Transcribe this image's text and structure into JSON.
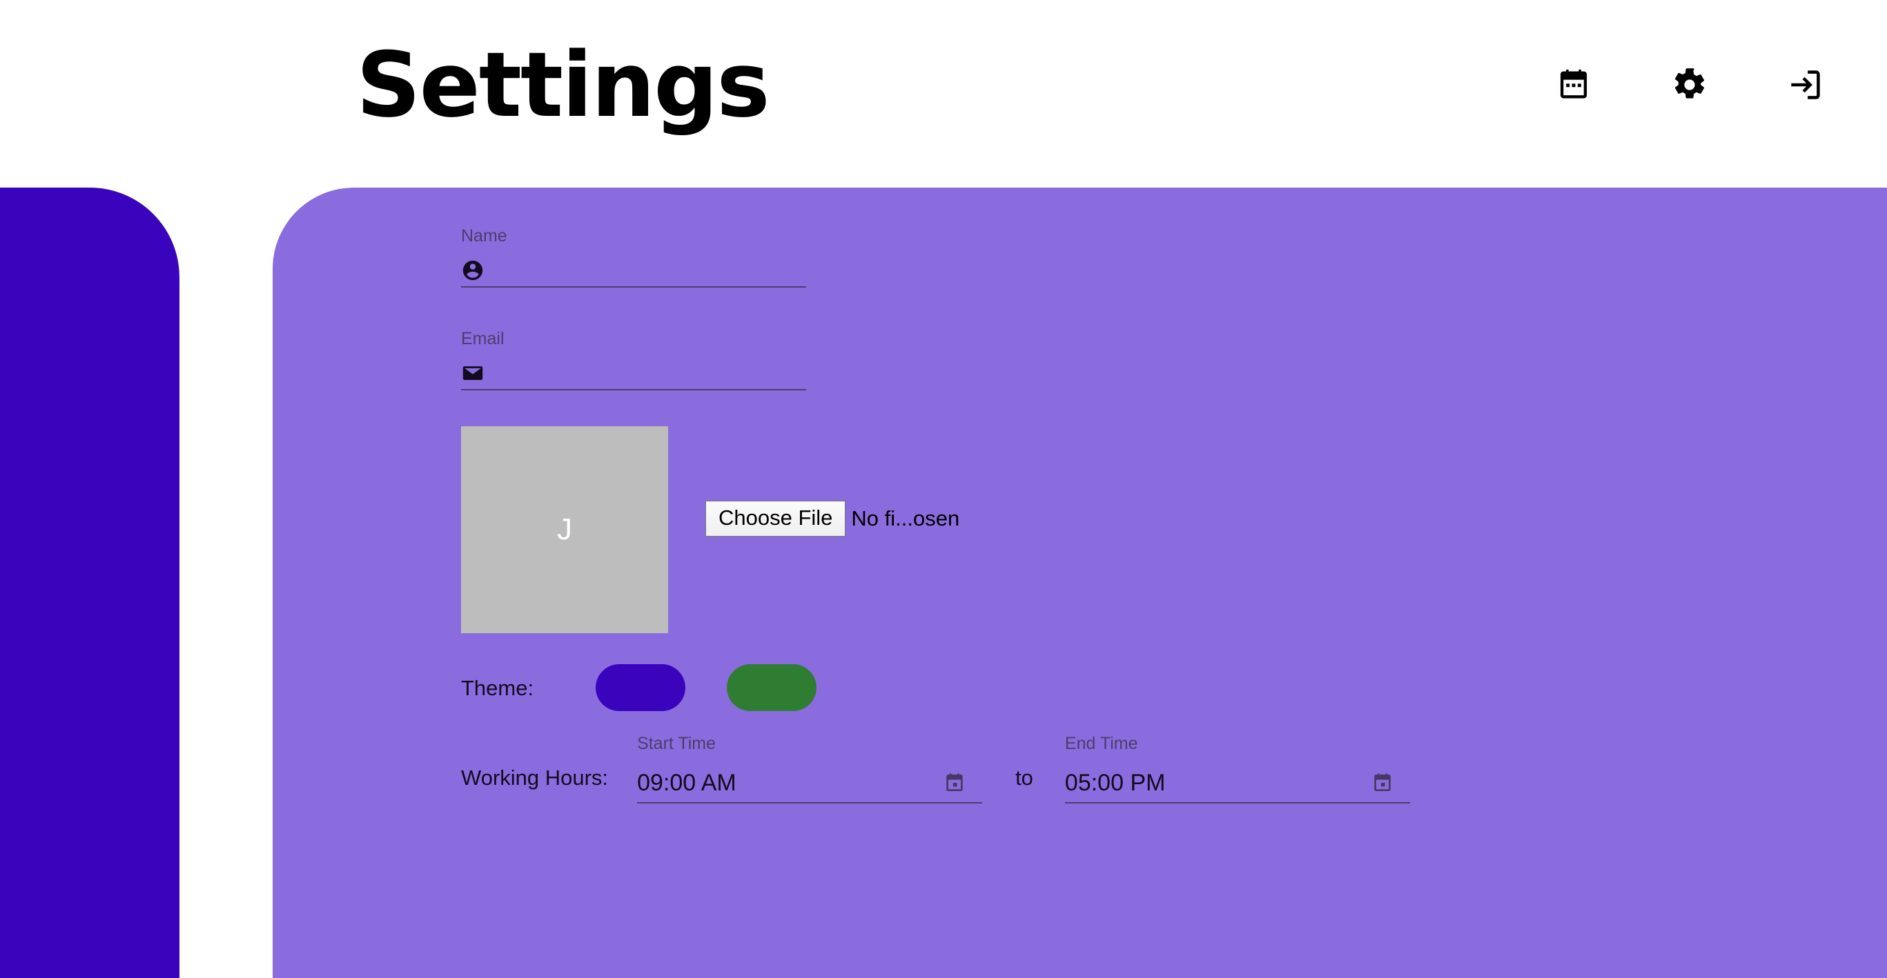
{
  "header": {
    "title": "Settings",
    "actions": [
      {
        "name": "calendar-view-icon",
        "icon": "calendar-icon"
      },
      {
        "name": "settings-icon",
        "icon": "gear-icon"
      },
      {
        "name": "logout-icon",
        "icon": "login-arrow-icon"
      }
    ]
  },
  "theme_colors": {
    "accent_panel": "#3A03BC",
    "content_panel": "#8B6CDE",
    "purple_swatch": "#3A03BC",
    "green_swatch": "#2E7D32",
    "avatar_bg": "#BDBDBD",
    "label_text": "#4C3C6E"
  },
  "form": {
    "name": {
      "label": "Name",
      "value": "",
      "placeholder": "",
      "icon": "account-circle-icon"
    },
    "email": {
      "label": "Email",
      "value": "",
      "placeholder": "",
      "icon": "email-icon"
    },
    "avatar": {
      "initial": "J"
    },
    "file_input": {
      "button_label": "Choose File",
      "status": "No fi...osen"
    },
    "theme": {
      "label": "Theme:",
      "options": [
        {
          "name": "purple",
          "color": "#3A03BC"
        },
        {
          "name": "green",
          "color": "#2E7D32"
        }
      ]
    },
    "working_hours": {
      "label": "Working Hours:",
      "separator": "to",
      "start": {
        "label": "Start Time",
        "value": "09:00 AM"
      },
      "end": {
        "label": "End Time",
        "value": "05:00 PM"
      }
    }
  }
}
